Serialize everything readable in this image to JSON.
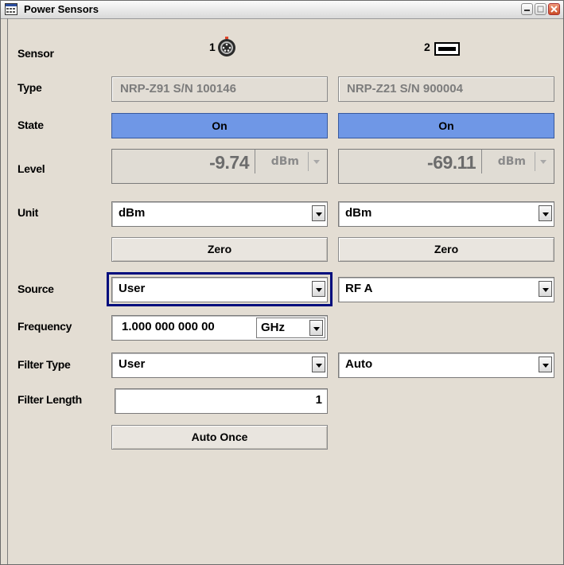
{
  "window": {
    "title": "Power Sensors"
  },
  "labels": {
    "sensor": "Sensor",
    "type": "Type",
    "state": "State",
    "level": "Level",
    "unit": "Unit",
    "source": "Source",
    "frequency": "Frequency",
    "filter_type": "Filter Type",
    "filter_length": "Filter Length"
  },
  "sensors": [
    {
      "number": "1",
      "connector_icon": "round-connector-icon",
      "type": "NRP-Z91 S/N 100146",
      "state": "On",
      "level_value": "-9.74",
      "level_unit": "dBm",
      "unit": "dBm",
      "zero_label": "Zero",
      "source": "User",
      "frequency_value": "1.000 000 000 00",
      "frequency_unit": "GHz",
      "filter_type": "User",
      "filter_length": "1",
      "auto_once_label": "Auto Once"
    },
    {
      "number": "2",
      "connector_icon": "usb-connector-icon",
      "type": "NRP-Z21 S/N 900004",
      "state": "On",
      "level_value": "-69.11",
      "level_unit": "dBm",
      "unit": "dBm",
      "zero_label": "Zero",
      "source": "RF A",
      "filter_type": "Auto"
    }
  ],
  "colors": {
    "state_on": "#6f97e6",
    "background": "#e3ddd3",
    "focus_border": "#000d7d"
  }
}
